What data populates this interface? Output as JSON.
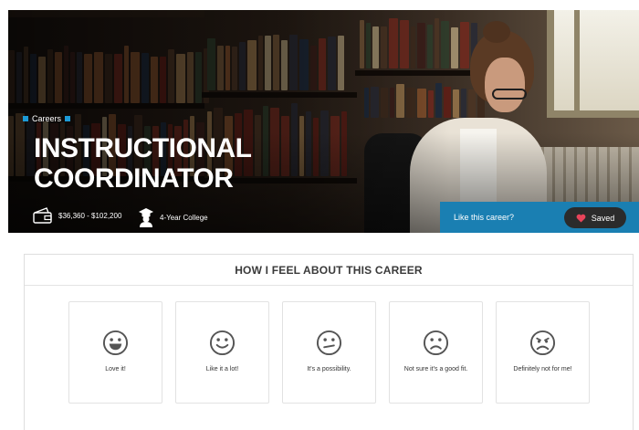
{
  "hero": {
    "breadcrumb": "Careers",
    "title_line1": "INSTRUCTIONAL",
    "title_line2": "COORDINATOR",
    "salary": "$36,360 - $102,200",
    "education": "4-Year College",
    "like_prompt": "Like this career?",
    "saved_label": "Saved",
    "accent": "#1a7fb2",
    "saved_heart_color": "#e8445a"
  },
  "feel": {
    "heading": "HOW I FEEL ABOUT THIS CAREER",
    "options": [
      {
        "label": "Love it!",
        "icon": "grin-face-icon"
      },
      {
        "label": "Like it a lot!",
        "icon": "smile-face-icon"
      },
      {
        "label": "It's a possibility.",
        "icon": "neutral-face-icon"
      },
      {
        "label": "Not sure it's a good fit.",
        "icon": "frown-face-icon"
      },
      {
        "label": "Definitely not for me!",
        "icon": "sad-face-icon"
      }
    ]
  }
}
